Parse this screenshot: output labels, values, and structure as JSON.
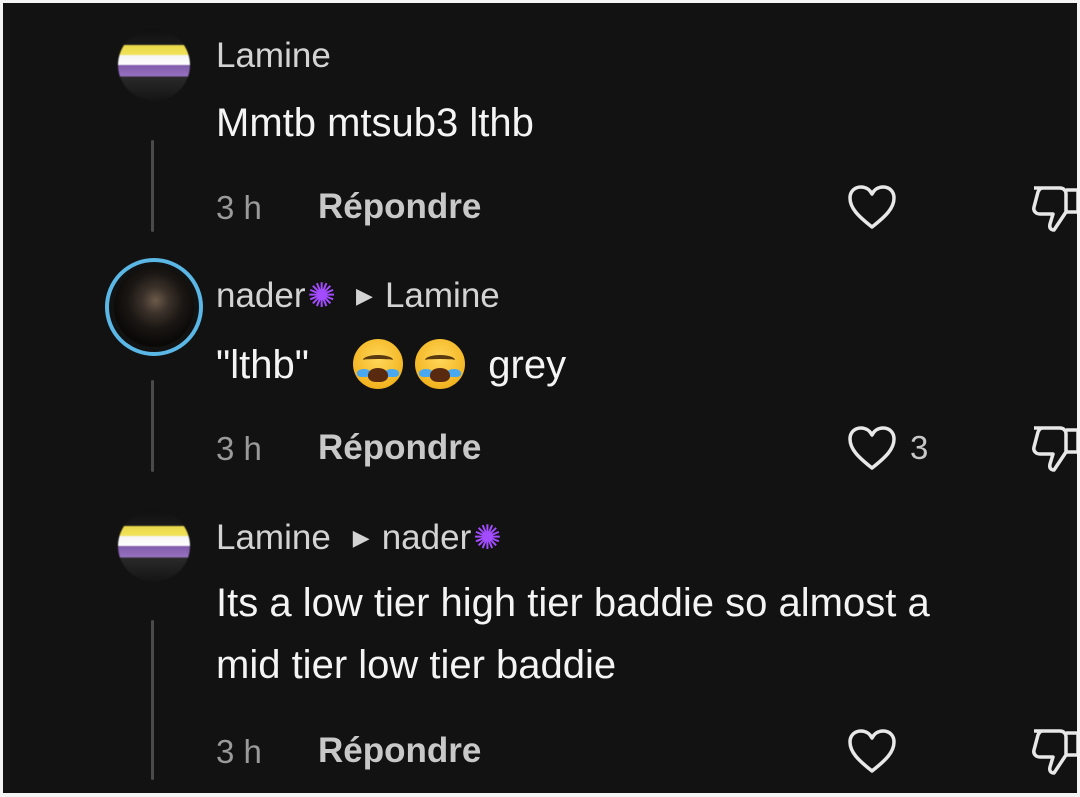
{
  "comments": [
    {
      "username": "Lamine",
      "reply_to": "",
      "text_lines": [
        "Mmtb mtsub3 lthb"
      ],
      "time": "3 h",
      "reply_label": "Répondre",
      "like_count": ""
    },
    {
      "username": "nader",
      "reply_to": "Lamine",
      "text_before": "\"lthb\"",
      "text_after": "grey",
      "time": "3 h",
      "reply_label": "Répondre",
      "like_count": "3"
    },
    {
      "username": "Lamine",
      "reply_to": "nader",
      "text_lines": [
        "Its a low tier high tier baddie so almost a",
        "mid tier low tier baddie"
      ],
      "time": "3 h",
      "reply_label": "Répondre",
      "like_count": ""
    }
  ],
  "icons": {
    "like": "heart-outline-icon",
    "dislike": "thumbs-down-outline-icon",
    "splat": "purple-splat-emoji",
    "reply_arrow": "triangle-right-icon",
    "crying": "loudly-crying-face-emoji"
  },
  "colors": {
    "background": "#121212",
    "story_ring": "#5ab7e6",
    "splat": "#a24bff",
    "muted_text": "#9a9a9a"
  }
}
